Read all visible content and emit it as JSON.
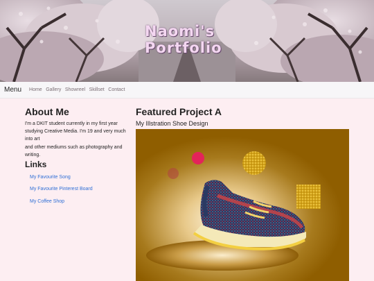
{
  "hero": {
    "title_line1": "Naomi's",
    "title_line2": "Portfolio"
  },
  "navbar": {
    "brand": "Menu",
    "links": [
      {
        "label": "Home"
      },
      {
        "label": "Gallery"
      },
      {
        "label": "Showreel"
      },
      {
        "label": "Skillset"
      },
      {
        "label": "Contact"
      }
    ]
  },
  "about": {
    "heading": "About Me",
    "lines": [
      "I'm a DKIT student currently in my first year studying Creative Media. I'm 19 and very much into art",
      "and other mediums such as photography and writing."
    ]
  },
  "links": {
    "heading": "Links",
    "items": [
      {
        "label": "My Favourite Song"
      },
      {
        "label": "My Favourite Pinterest Board"
      },
      {
        "label": "My Coffee Shop"
      }
    ]
  },
  "project": {
    "heading": "Featured Project A",
    "subtitle": "My Illstration Shoe Design"
  },
  "colors": {
    "page_background": "#fdeef2",
    "link": "#2f6fd6",
    "hero_title": "#f4d7f1",
    "artwork_background": "#8f5e00"
  }
}
